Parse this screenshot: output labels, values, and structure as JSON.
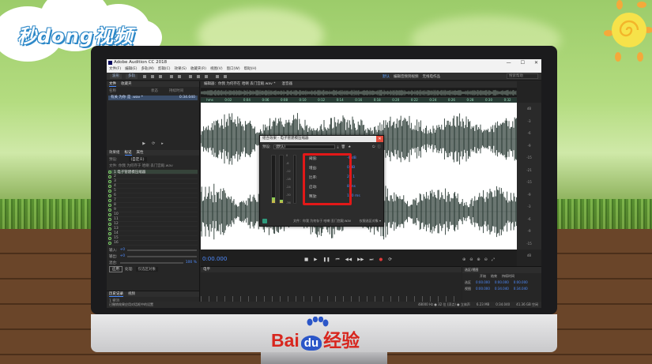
{
  "watermark": {
    "logo_text": "秒dong视频"
  },
  "branding": {
    "bai": "Bai",
    "du": "du",
    "suffix": "经验"
  },
  "app": {
    "title": "Adobe Audition CC 2018",
    "window_controls": [
      "—",
      "☐",
      "✕"
    ],
    "menus": [
      "文件(F)",
      "编辑(E)",
      "多轨(M)",
      "剪辑(C)",
      "效果(S)",
      "收藏夹(R)",
      "视图(V)",
      "窗口(W)",
      "帮助(H)"
    ],
    "toolbar": {
      "wave_btn": "波形",
      "multitrack_btn": "多轨",
      "workspaces": [
        "默认",
        "编辑音频到视频",
        "无线电作品"
      ],
      "search_placeholder": "搜索帮助"
    }
  },
  "files_panel": {
    "tabs": [
      "文件",
      "收藏夹"
    ],
    "columns": [
      "名称",
      "状态",
      "持续时间"
    ],
    "file_row": {
      "name": "有关 为你 是 .wav *",
      "duration": "0:34.040"
    }
  },
  "effects_rack": {
    "tabs": [
      "效果组",
      "标记",
      "属性"
    ],
    "preset_label": "预设:",
    "preset_value": "(自定义)",
    "clip_label": "文件: 你我 为何存于 哈喇 丢门宫殿.wav",
    "slots": [
      "1 电子管建模压缩器",
      "2",
      "3",
      "4",
      "5",
      "6",
      "7",
      "8",
      "9",
      "10",
      "11",
      "12",
      "13",
      "14",
      "15",
      "16"
    ],
    "input_label": "输入:",
    "output_label": "输出:",
    "input_db": "+0",
    "output_db": "+0",
    "mix_label": "混合:",
    "mix_value": "100 %",
    "apply_button": "应用",
    "process_label": "处理:",
    "process_value": "仅选区对象"
  },
  "history_panel": {
    "tabs": [
      "历史记录",
      "视频"
    ],
    "items": [
      "1 撤消"
    ],
    "status": "已撤销效果应用对话框中的设置"
  },
  "editor": {
    "tabs": [
      "编辑器：你我 为何存在 哈喇 丢门宫殿.wav *",
      "混音器"
    ],
    "ruler_ticks": [
      "hms",
      "0:02",
      "0:04",
      "0:06",
      "0:08",
      "0:10",
      "0:12",
      "0:14",
      "0:16",
      "0:18",
      "0:20",
      "0:22",
      "0:24",
      "0:26",
      "0:28",
      "0:30",
      "0:32"
    ],
    "hud_db": "+0 dB",
    "db_scale": [
      "dB",
      "-3",
      "-6",
      "-9",
      "-15",
      "-21",
      "-15",
      "-9",
      "-3",
      "-6",
      "-9",
      "-15",
      "dB"
    ],
    "timecode": "0:00.000"
  },
  "dialog": {
    "title": "组合效果 - 电子管建模压缩器",
    "preset_label": "预设:",
    "preset_value": "(默认)",
    "meter_labels": [
      "0",
      "-6",
      "-12",
      "-18",
      "-24",
      "-30",
      "-36"
    ],
    "params": [
      {
        "label": "阈值:",
        "value": "-6 dB"
      },
      {
        "label": "增益:",
        "value": "0 dB"
      },
      {
        "label": "比率:",
        "value": "2 : 1"
      },
      {
        "label": "启动:",
        "value": "8 ms"
      },
      {
        "label": "释放:",
        "value": "120 ms"
      }
    ],
    "footer_text": "文件：你我 为何存于 哈喇 丢门宫殿.wav",
    "footer_right": "仅限选区对象 ▾",
    "accent_color": "#e21818"
  },
  "mixer": {
    "title": "电平"
  },
  "selection_view": {
    "title": "选区/视图",
    "headers": [
      "开始",
      "结束",
      "持续时间"
    ],
    "rows": [
      {
        "label": "选区",
        "start": "0:00.000",
        "end": "0:00.000",
        "dur": "0:00.000"
      },
      {
        "label": "视图",
        "start": "0:00.000",
        "end": "0:34.040",
        "dur": "0:34.040"
      }
    ]
  },
  "statusbar": {
    "left": "已撤销效果应用对话框中的设置",
    "sample": "48000 Hz ● 32 位 (浮点) ● 立体声",
    "size": "6.23 MB",
    "duration": "0:34.040",
    "free": "41.36 GB 空闲"
  }
}
